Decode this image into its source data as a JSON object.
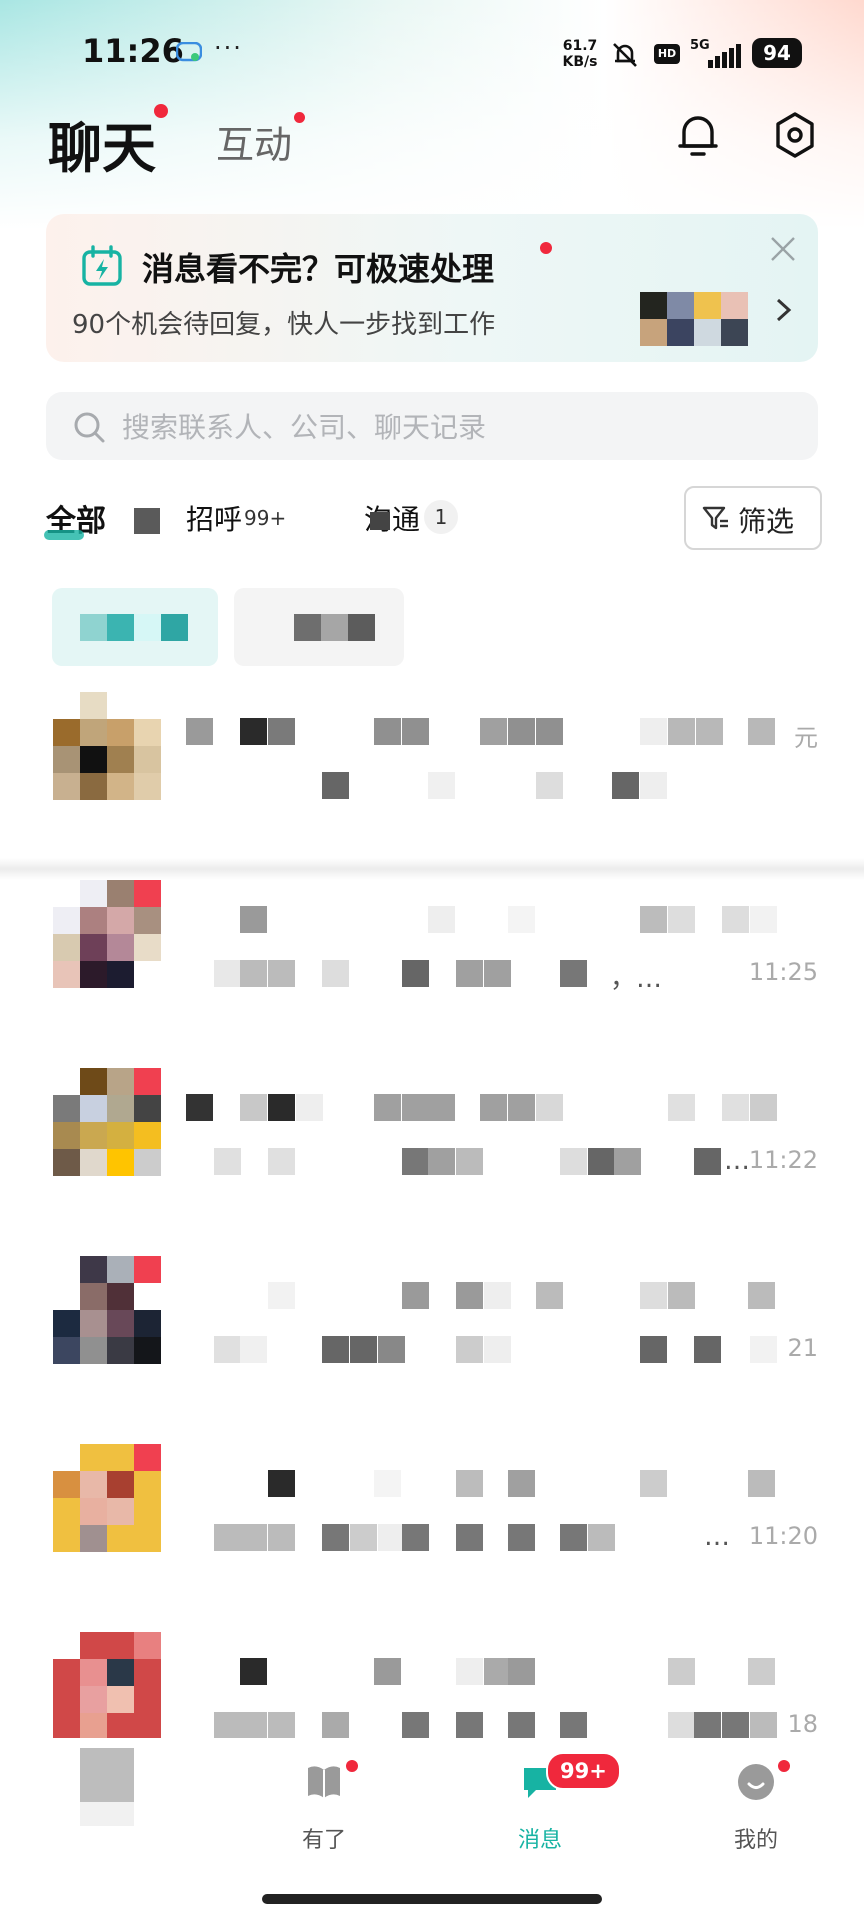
{
  "status_bar": {
    "time": "11:26",
    "more": "···",
    "net_speed_value": "61.7",
    "net_speed_unit": "KB/s",
    "hd": "HD",
    "network": "5G",
    "battery": "94"
  },
  "header": {
    "tab_chat": "聊天",
    "tab_interact": "互动",
    "accent_color": "#f0283c"
  },
  "banner": {
    "title": "消息看不完？可极速处理",
    "subtitle": "90个机会待回复，快人一步找到工作"
  },
  "search": {
    "placeholder": "搜索联系人、公司、聊天记录"
  },
  "filters": {
    "all": "全部",
    "greet": "招呼",
    "greet_count": "99+",
    "communicate": "沟通",
    "communicate_count": "1",
    "filter_button": "筛选"
  },
  "chats": [
    {
      "time": "元"
    },
    {
      "time": "11:25",
      "ellipsis": "，…"
    },
    {
      "time": "11:22",
      "ellipsis": "…"
    },
    {
      "time": "21"
    },
    {
      "time": "11:20",
      "ellipsis": "…"
    },
    {
      "time": "18"
    }
  ],
  "bottom_nav": {
    "items": [
      {
        "label": ""
      },
      {
        "label": "有了"
      },
      {
        "label": "消息",
        "badge": "99+"
      },
      {
        "label": "我的"
      }
    ],
    "active_color": "#17b3a3"
  }
}
